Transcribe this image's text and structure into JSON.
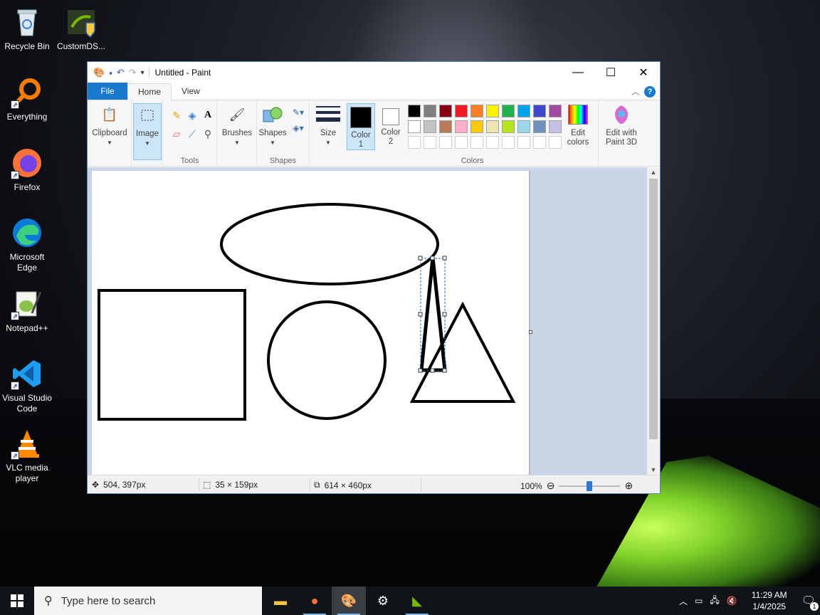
{
  "desktop": {
    "icons": [
      {
        "label": "Recycle Bin",
        "icon": "recycle-bin-icon"
      },
      {
        "label": "CustomDS...",
        "icon": "nvidia-shield-icon"
      },
      {
        "label": "Everything",
        "icon": "magnifier-icon"
      },
      {
        "label": "Firefox",
        "icon": "firefox-icon"
      },
      {
        "label": "Microsoft Edge",
        "icon": "edge-icon"
      },
      {
        "label": "Notepad++",
        "icon": "notepadpp-icon"
      },
      {
        "label": "Visual Studio Code",
        "icon": "vscode-icon"
      },
      {
        "label": "VLC media player",
        "icon": "vlc-icon"
      }
    ]
  },
  "paint": {
    "title": "Untitled - Paint",
    "tabs": {
      "file": "File",
      "home": "Home",
      "view": "View"
    },
    "help": "?",
    "groups": {
      "clipboard": "Clipboard",
      "image": "Image",
      "tools": "Tools",
      "brushes": "Brushes",
      "shapes": "Shapes",
      "size": "Size",
      "color1": "Color\n1",
      "color2": "Color\n2",
      "colors": "Colors",
      "edit_colors": "Edit\ncolors",
      "edit_3d": "Edit with\nPaint 3D"
    },
    "group_labels": {
      "tools": "Tools",
      "shapes": "Shapes",
      "colors": "Colors"
    },
    "color1_value": "#000000",
    "color2_value": "#ffffff",
    "palette_row1": [
      "#000000",
      "#7f7f7f",
      "#880015",
      "#ed1c24",
      "#ff7f27",
      "#fff200",
      "#22b14c",
      "#00a2e8",
      "#3f48cc",
      "#a349a4"
    ],
    "palette_row2": [
      "#ffffff",
      "#c3c3c3",
      "#b97a57",
      "#ffaec9",
      "#ffc90e",
      "#efe4b0",
      "#b5e61d",
      "#99d9ea",
      "#7092be",
      "#c8bfe7"
    ],
    "status": {
      "cursor_pos": "504, 397px",
      "selection_size": "35 × 159px",
      "canvas_size": "614 × 460px",
      "zoom": "100%",
      "zoom_fraction": 0.5
    }
  },
  "taskbar": {
    "search_placeholder": "Type here to search",
    "time": "11:29 AM",
    "date": "1/4/2025",
    "notification_count": "1"
  }
}
